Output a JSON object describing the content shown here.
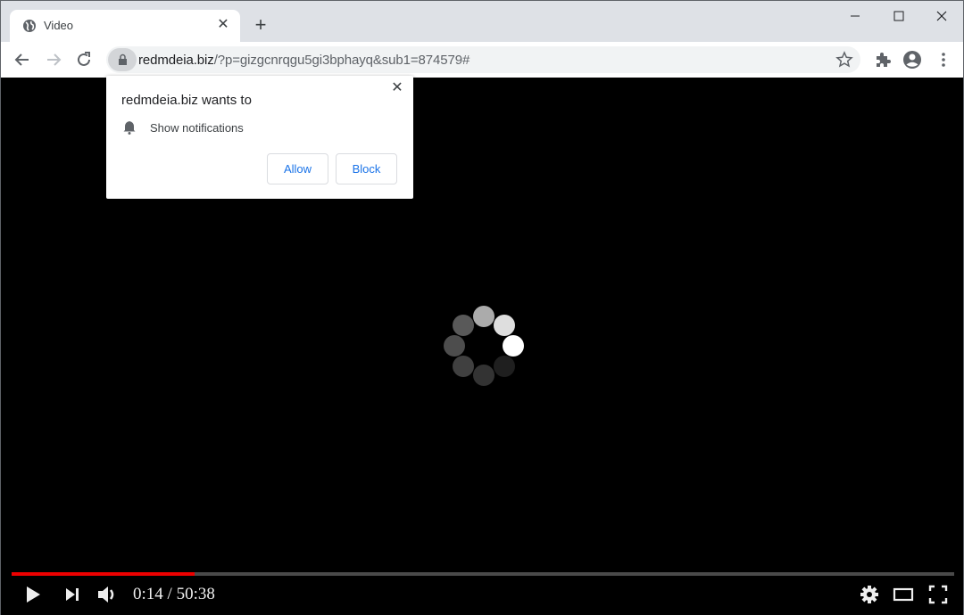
{
  "browser": {
    "tab": {
      "title": "Video",
      "icon": "globe-icon"
    },
    "new_tab_symbol": "+",
    "window_controls": [
      "minimize",
      "maximize",
      "close"
    ],
    "url": {
      "domain": "redmdeia.biz",
      "rest": "/?p=gizgcnrqgu5gi3bphayq&sub1=874579#"
    }
  },
  "popup": {
    "title": "redmdeia.biz wants to",
    "permission": "Show notifications",
    "allow_label": "Allow",
    "block_label": "Block",
    "close_symbol": "✕"
  },
  "player": {
    "current_time": "0:14",
    "separator": " / ",
    "duration": "50:38",
    "progress_fraction": 0.194,
    "spinner_dot_brightness": [
      0.67,
      0.87,
      1.0,
      0.12,
      0.2,
      0.25,
      0.3,
      0.35
    ],
    "accent_color": "#ee0000"
  }
}
